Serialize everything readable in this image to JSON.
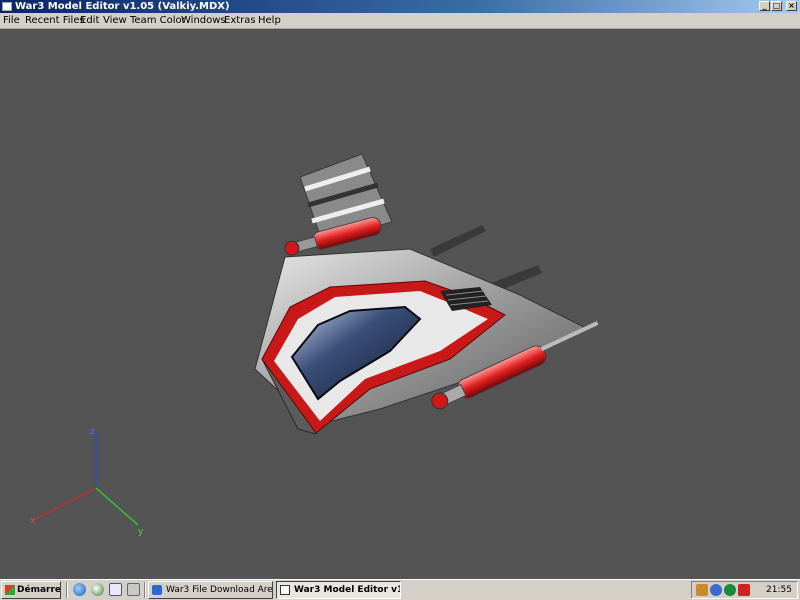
{
  "window": {
    "title": "War3 Model Editor v1.05 (Valkiy.MDX)",
    "controls": [
      "_",
      "□",
      "×"
    ]
  },
  "menu": [
    "File",
    "Recent Files",
    "Edit",
    "View",
    "Team Color",
    "Windows",
    "Extras",
    "Help"
  ],
  "viewport": {
    "background": "#545454",
    "axes": {
      "z": "z",
      "x": "x",
      "y": "y"
    },
    "axis_colors": {
      "x": "#c03030",
      "y": "#30c030",
      "z": "#3048c8"
    }
  },
  "taskbar": {
    "start_label": "Démarrer",
    "tasks": [
      {
        "label": "War3 File Download Are..."
      },
      {
        "label": "War3 Model Editor v1..."
      }
    ],
    "clock": "21:55"
  }
}
